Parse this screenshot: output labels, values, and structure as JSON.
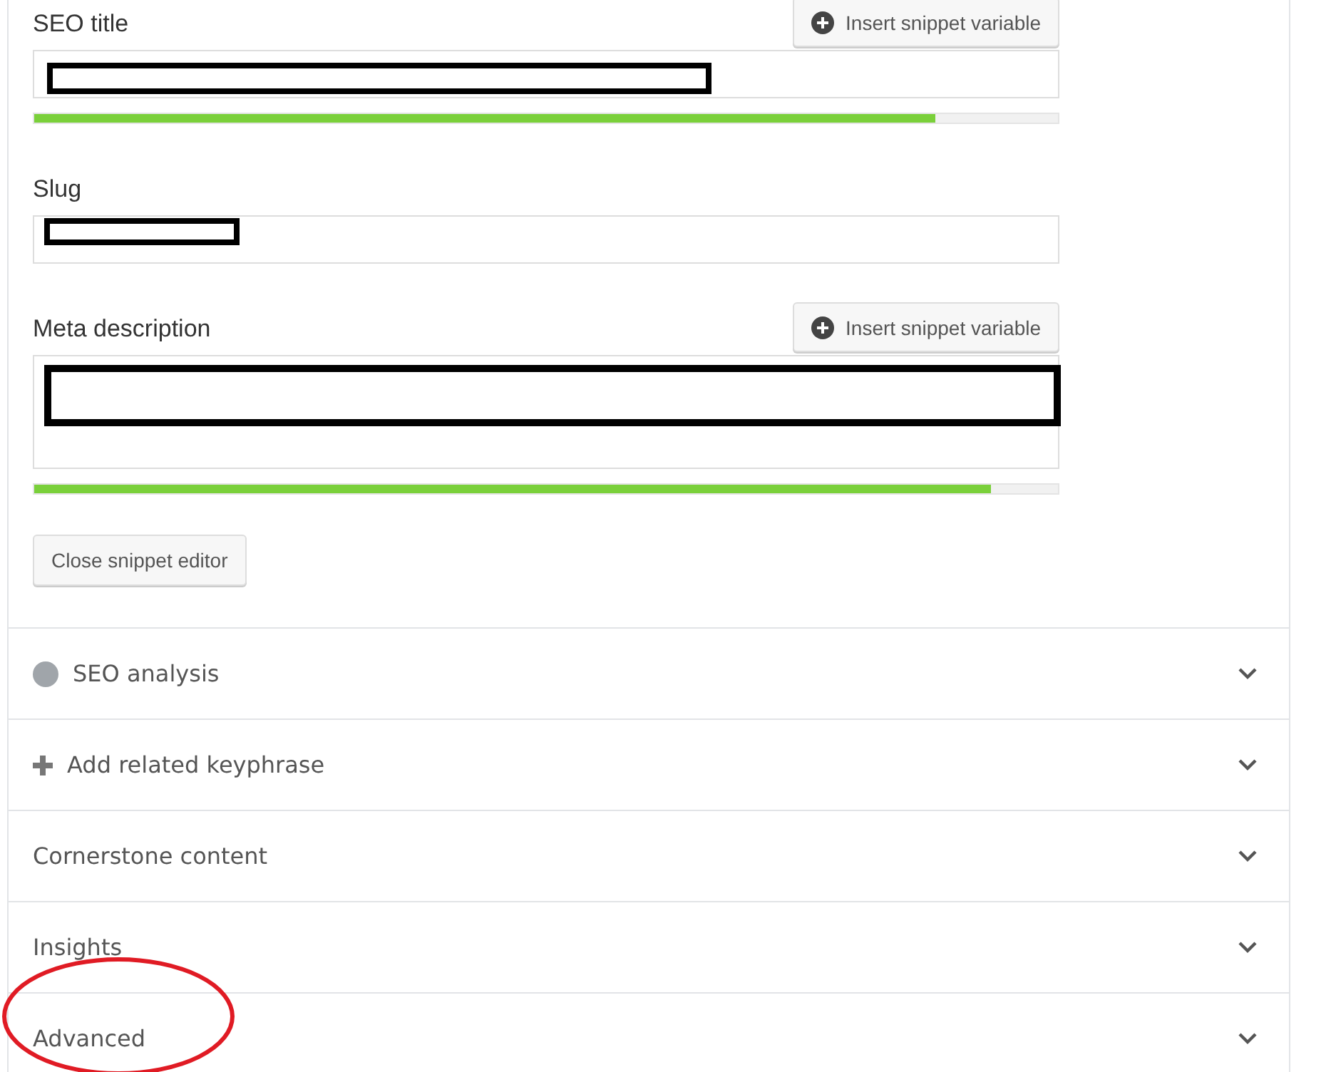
{
  "snippet_editor": {
    "fields": [
      {
        "kind": "input",
        "label": "SEO title",
        "button": "Insert snippet variable",
        "progress": {
          "level": 0.88
        }
      },
      {
        "kind": "input",
        "label": "Slug"
      },
      {
        "kind": "textarea",
        "label": "Meta description",
        "button": "Insert snippet variable",
        "progress": {
          "level": 0.935
        }
      }
    ],
    "close_button": "Close snippet editor"
  },
  "sections": [
    {
      "kind": "score",
      "title": "SEO analysis",
      "expanded": false
    },
    {
      "kind": "add",
      "title": "Add related keyphrase",
      "expanded": false
    },
    {
      "kind": "plain",
      "title": "Cornerstone content",
      "expanded": false
    },
    {
      "kind": "plain",
      "title": "Insights",
      "expanded": false
    },
    {
      "kind": "plain",
      "title": "Advanced",
      "expanded": false
    }
  ]
}
